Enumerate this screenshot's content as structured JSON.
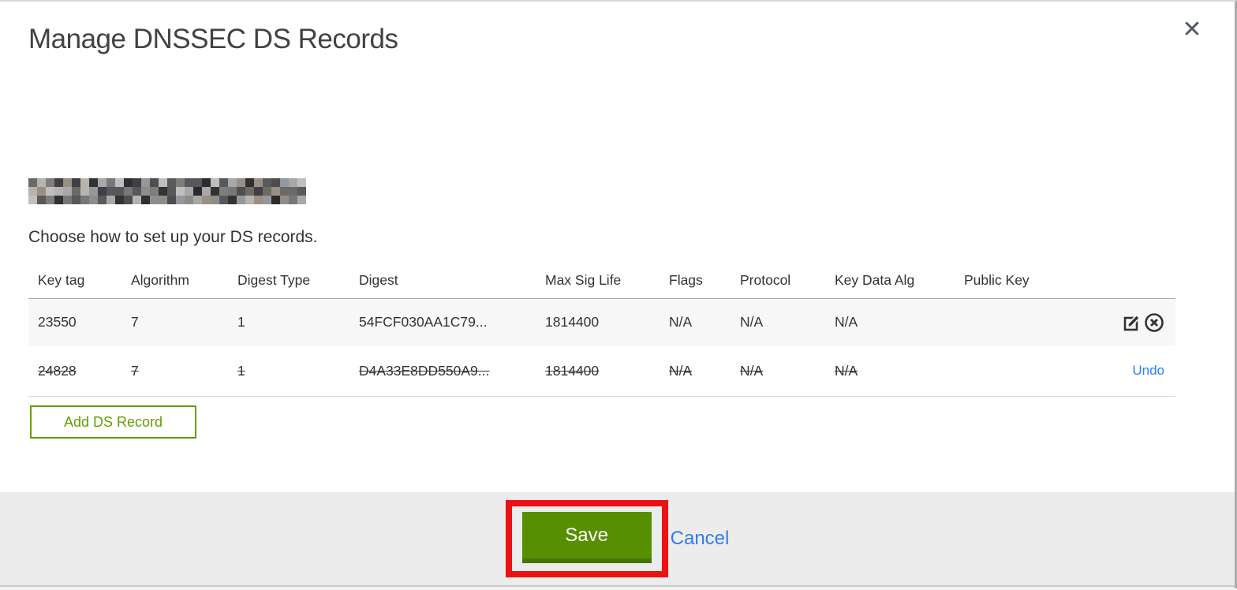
{
  "modal": {
    "title": "Manage DNSSEC DS Records",
    "close_label": "✕",
    "instruction": "Choose how to set up your DS records.",
    "table": {
      "headers": {
        "key_tag": "Key tag",
        "algorithm": "Algorithm",
        "digest_type": "Digest Type",
        "digest": "Digest",
        "max_sig_life": "Max Sig Life",
        "flags": "Flags",
        "protocol": "Protocol",
        "key_data_alg": "Key Data Alg",
        "public_key": "Public Key"
      },
      "rows": [
        {
          "key_tag": "23550",
          "algorithm": "7",
          "digest_type": "1",
          "digest": "54FCF030AA1C79...",
          "max_sig_life": "1814400",
          "flags": "N/A",
          "protocol": "N/A",
          "key_data_alg": "N/A",
          "public_key": "",
          "state": "normal",
          "actions": [
            "edit",
            "delete"
          ]
        },
        {
          "key_tag": "24828",
          "algorithm": "7",
          "digest_type": "1",
          "digest": "D4A33E8DD550A9...",
          "max_sig_life": "1814400",
          "flags": "N/A",
          "protocol": "N/A",
          "key_data_alg": "N/A",
          "public_key": "",
          "state": "deleted",
          "undo_label": "Undo"
        }
      ]
    },
    "add_button_label": "Add DS Record",
    "footer": {
      "save_label": "Save",
      "cancel_label": "Cancel"
    }
  },
  "colors": {
    "accent_green": "#578f02",
    "outline_green": "#669c00",
    "link_blue": "#2f7cf0",
    "annotation_red": "#ee1111",
    "footer_gray": "#ececec",
    "row_gray": "#f7f7f7"
  }
}
